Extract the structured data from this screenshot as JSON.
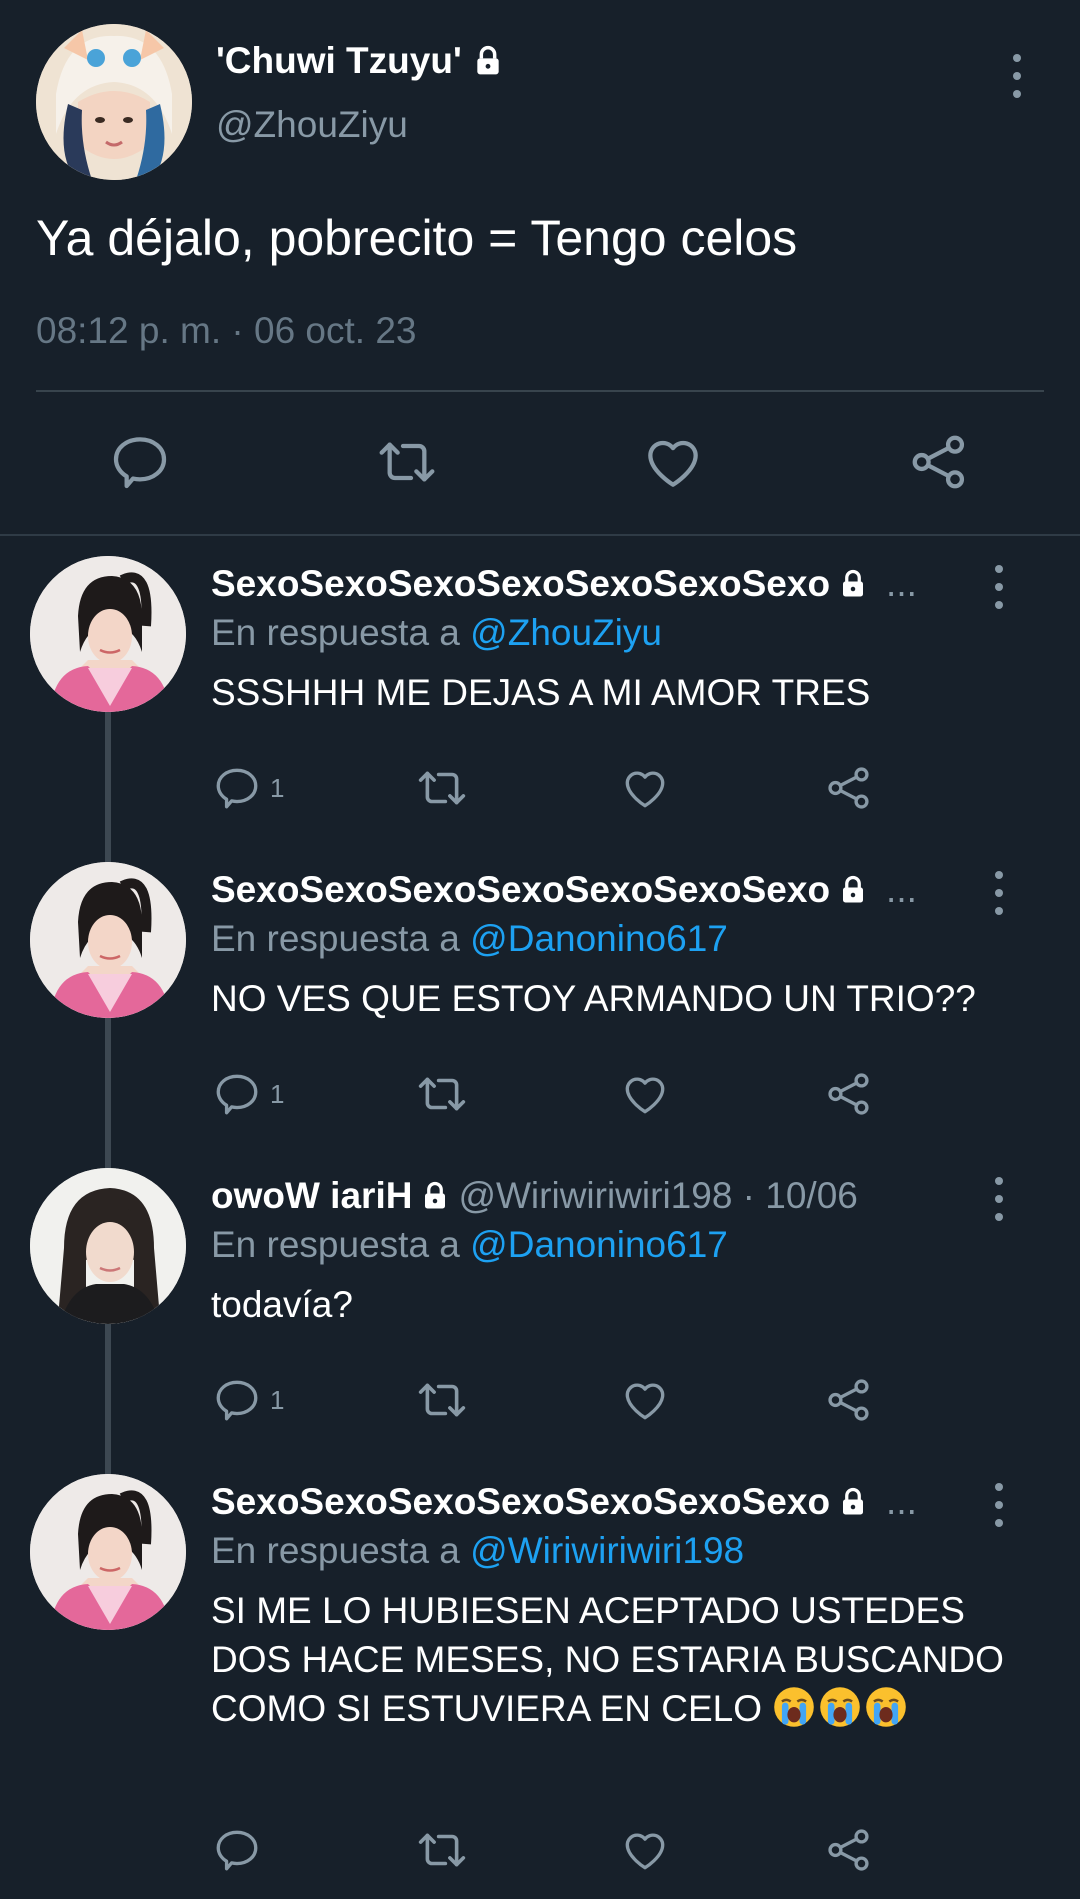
{
  "main_tweet": {
    "display_name": "'Chuwi Tzuyu'",
    "handle": "@ZhouZiyu",
    "text": "Ya déjalo, pobrecito = Tengo celos",
    "meta": "08:12 p. m. · 06 oct. 23",
    "locked": true
  },
  "replies": [
    {
      "display_name": "SexoSexoSexoSexoSexoSexoSexo",
      "handle": "",
      "ellipsis": "...",
      "reply_prefix": "En respuesta a ",
      "reply_to": "@ZhouZiyu",
      "text": "SSSHHH ME DEJAS A MI AMOR TRES",
      "reply_count": "1"
    },
    {
      "display_name": "SexoSexoSexoSexoSexoSexoSexo",
      "handle": "",
      "ellipsis": "...",
      "reply_prefix": "En respuesta a ",
      "reply_to": "@Danonino617",
      "text": "NO VES QUE ESTOY ARMANDO UN TRIO??",
      "reply_count": "1"
    },
    {
      "display_name": "owoW iariH",
      "handle": "@Wiriwiriwiri198 · 10/06",
      "ellipsis": "",
      "reply_prefix": "En respuesta a ",
      "reply_to": "@Danonino617",
      "text": "todavía?",
      "reply_count": "1"
    },
    {
      "display_name": "SexoSexoSexoSexoSexoSexoSexo",
      "handle": "",
      "ellipsis": "...",
      "reply_prefix": "En respuesta a ",
      "reply_to": "@Wiriwiriwiri198",
      "text": "SI ME LO HUBIESEN ACEPTADO USTEDES DOS HACE MESES, NO ESTARIA BUSCANDO COMO SI ESTUVIERA EN CELO",
      "emoji": "😭😭😭",
      "reply_count": ""
    }
  ],
  "colors": {
    "background": "#17202a",
    "secondary_text": "#8899a6",
    "mention": "#1da1f2",
    "divider": "#38444d"
  },
  "icons": [
    "lock-icon",
    "more-options-icon",
    "reply-icon",
    "retweet-icon",
    "like-icon",
    "share-icon"
  ]
}
